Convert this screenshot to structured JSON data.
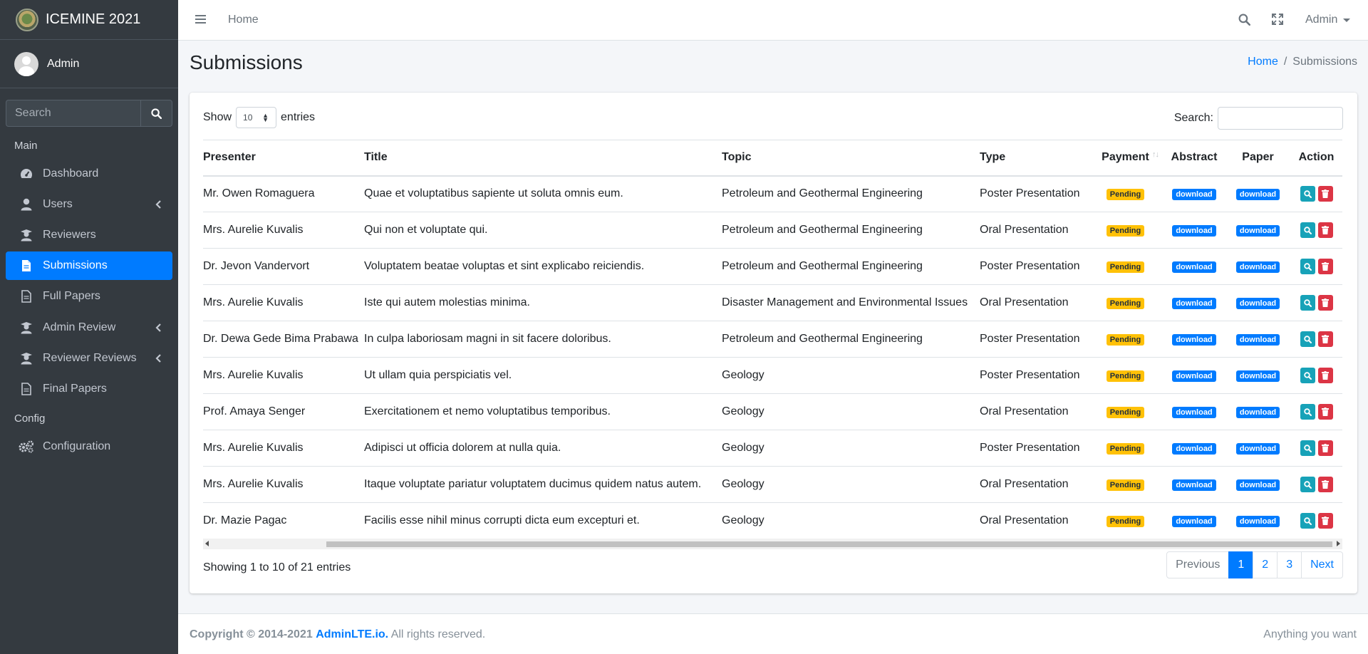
{
  "brand": {
    "name": "ICEMINE 2021"
  },
  "user": {
    "name": "Admin"
  },
  "sidebar": {
    "search_placeholder": "Search",
    "header_main": "Main",
    "header_config": "Config",
    "items": [
      {
        "label": "Dashboard",
        "icon": "tachometer-icon"
      },
      {
        "label": "Users",
        "icon": "user-icon",
        "has_submenu": true
      },
      {
        "label": "Reviewers",
        "icon": "graduate-icon"
      },
      {
        "label": "Submissions",
        "icon": "file-icon",
        "active": true
      },
      {
        "label": "Full Papers",
        "icon": "file-icon"
      },
      {
        "label": "Admin Review",
        "icon": "graduate-icon",
        "has_submenu": true
      },
      {
        "label": "Reviewer Reviews",
        "icon": "graduate-icon",
        "has_submenu": true
      },
      {
        "label": "Final Papers",
        "icon": "file-icon"
      }
    ],
    "config_items": [
      {
        "label": "Configuration",
        "icon": "cogs-icon"
      }
    ]
  },
  "topbar": {
    "home": "Home",
    "admin": "Admin"
  },
  "page": {
    "title": "Submissions"
  },
  "breadcrumb": {
    "home": "Home",
    "sep": "/",
    "current": "Submissions"
  },
  "table_controls": {
    "show_label": "Show",
    "entries_label": "entries",
    "page_size": "10",
    "search_label": "Search:"
  },
  "table": {
    "columns": [
      "Presenter",
      "Title",
      "Topic",
      "Type",
      "Payment",
      "Abstract",
      "Paper",
      "Action"
    ],
    "badge_pending": "Pending",
    "badge_download": "download",
    "rows": [
      {
        "presenter": "Mr. Owen Romaguera",
        "title": "Quae et voluptatibus sapiente ut soluta omnis eum.",
        "topic": "Petroleum and Geothermal Engineering",
        "type": "Poster Presentation"
      },
      {
        "presenter": "Mrs. Aurelie Kuvalis",
        "title": "Qui non et voluptate qui.",
        "topic": "Petroleum and Geothermal Engineering",
        "type": "Oral Presentation"
      },
      {
        "presenter": "Dr. Jevon Vandervort",
        "title": "Voluptatem beatae voluptas et sint explicabo reiciendis.",
        "topic": "Petroleum and Geothermal Engineering",
        "type": "Poster Presentation"
      },
      {
        "presenter": "Mrs. Aurelie Kuvalis",
        "title": "Iste qui autem molestias minima.",
        "topic": "Disaster Management and Environmental Issues",
        "type": "Oral Presentation"
      },
      {
        "presenter": "Dr. Dewa Gede Bima Prabawa",
        "title": "In culpa laboriosam magni in sit facere doloribus.",
        "topic": "Petroleum and Geothermal Engineering",
        "type": "Poster Presentation"
      },
      {
        "presenter": "Mrs. Aurelie Kuvalis",
        "title": "Ut ullam quia perspiciatis vel.",
        "topic": "Geology",
        "type": "Poster Presentation"
      },
      {
        "presenter": "Prof. Amaya Senger",
        "title": "Exercitationem et nemo voluptatibus temporibus.",
        "topic": "Geology",
        "type": "Oral Presentation"
      },
      {
        "presenter": "Mrs. Aurelie Kuvalis",
        "title": "Adipisci ut officia dolorem at nulla quia.",
        "topic": "Geology",
        "type": "Poster Presentation"
      },
      {
        "presenter": "Mrs. Aurelie Kuvalis",
        "title": "Itaque voluptate pariatur voluptatem ducimus quidem natus autem.",
        "topic": "Geology",
        "type": "Oral Presentation"
      },
      {
        "presenter": "Dr. Mazie Pagac",
        "title": "Facilis esse nihil minus corrupti dicta eum excepturi et.",
        "topic": "Geology",
        "type": "Oral Presentation"
      }
    ]
  },
  "info": "Showing 1 to 10 of 21 entries",
  "pagination": {
    "previous": "Previous",
    "pages": [
      "1",
      "2",
      "3"
    ],
    "current": "1",
    "next": "Next"
  },
  "footer": {
    "copyright": "Copyright © 2014-2021",
    "brand_link": "AdminLTE.io.",
    "rights": "All rights reserved.",
    "right_text": "Anything you want"
  },
  "colors": {
    "primary": "#007bff",
    "sidebar": "#343a40",
    "warning": "#ffc107",
    "info": "#17a2b8",
    "danger": "#dc3545"
  }
}
